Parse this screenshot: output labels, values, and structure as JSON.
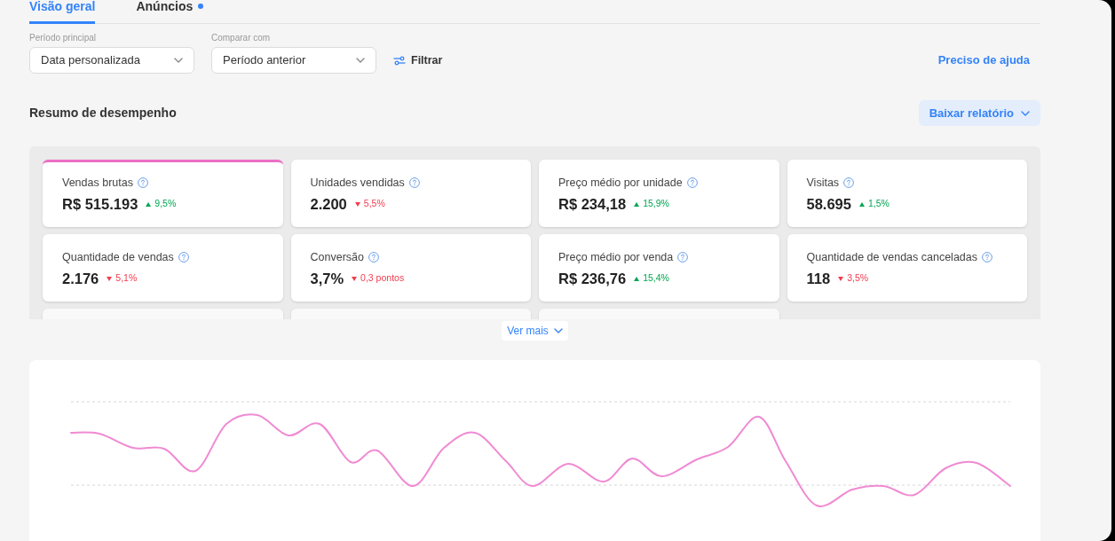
{
  "tabs": [
    {
      "label": "Visão geral",
      "selected": true,
      "dot": false
    },
    {
      "label": "Anúncios",
      "selected": false,
      "dot": true
    }
  ],
  "filters": {
    "fields": [
      {
        "label": "Período principal",
        "value": "Data personalizada"
      },
      {
        "label": "Comparar com",
        "value": "Período anterior"
      }
    ],
    "filter_button": "Filtrar",
    "help_link": "Preciso de ajuda"
  },
  "summary": {
    "title": "Resumo de desempenho",
    "download_button": "Baixar relatório",
    "metrics": [
      {
        "label": "Vendas brutas",
        "value": "R$ 515.193",
        "change": "9,5%",
        "rising": true,
        "selected": true
      },
      {
        "label": "Unidades vendidas",
        "value": "2.200",
        "change": "5,5%",
        "rising": false,
        "selected": false
      },
      {
        "label": "Preço médio por unidade",
        "value": "R$ 234,18",
        "change": "15,9%",
        "rising": true,
        "selected": false
      },
      {
        "label": "Visitas",
        "value": "58.695",
        "change": "1,5%",
        "rising": true,
        "selected": false
      },
      {
        "label": "Quantidade de vendas",
        "value": "2.176",
        "change": "5,1%",
        "rising": false,
        "selected": false
      },
      {
        "label": "Conversão",
        "value": "3,7%",
        "change": "0,3 pontos",
        "rising": false,
        "selected": false
      },
      {
        "label": "Preço médio por venda",
        "value": "R$ 236,76",
        "change": "15,4%",
        "rising": true,
        "selected": false
      },
      {
        "label": "Quantidade de vendas canceladas",
        "value": "118",
        "change": "3,5%",
        "rising": false,
        "selected": false
      }
    ],
    "more_button": "Ver mais"
  }
}
